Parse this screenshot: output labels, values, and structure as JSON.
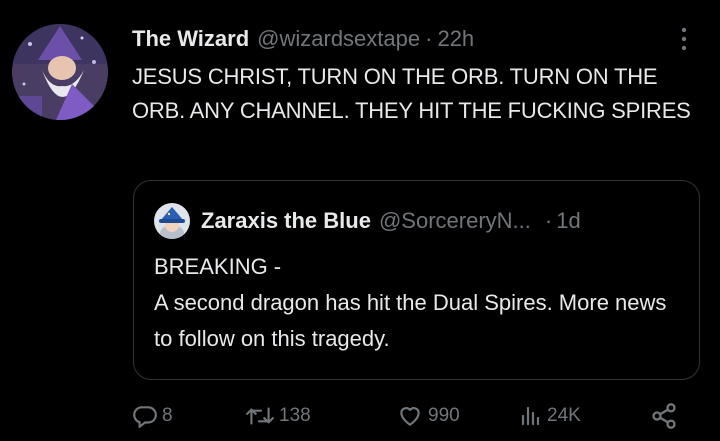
{
  "tweet": {
    "author_name": "The Wizard",
    "author_handle": "@wizardsextape",
    "separator": "·",
    "time": "22h",
    "text": "JESUS CHRIST, TURN ON THE ORB. TURN ON THE ORB. ANY CHANNEL. THEY HIT THE FUCKING SPIRES",
    "avatar_icon": "wizard-avatar",
    "more_icon": "more-vertical-icon"
  },
  "quoted_tweet": {
    "author_name": "Zaraxis the Blue",
    "author_handle": "@SorcereryN...",
    "separator": "·",
    "time": "1d",
    "text_line1": "BREAKING -",
    "text_line2": "A second dragon has hit the Dual Spires. More news to follow on this tragedy.",
    "avatar_icon": "wizard-hat-avatar"
  },
  "actions": {
    "reply_count": "8",
    "retweet_count": "138",
    "like_count": "990",
    "views_count": "24K",
    "reply_icon": "reply-icon",
    "retweet_icon": "retweet-icon",
    "like_icon": "heart-icon",
    "views_icon": "views-icon",
    "share_icon": "share-icon"
  },
  "colors": {
    "background": "#000000",
    "text": "#e7e9ea",
    "muted": "#71767b",
    "border": "#2f3336"
  }
}
